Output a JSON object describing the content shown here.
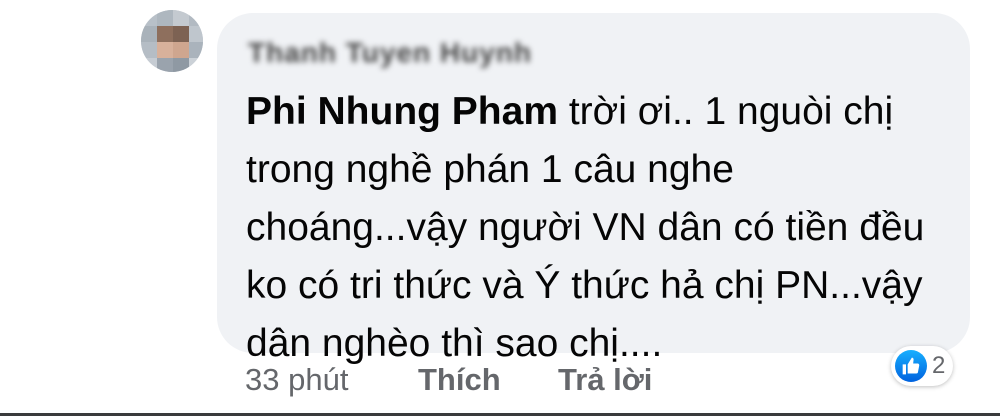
{
  "comment": {
    "author_name": "Thanh Tuyen Huynh",
    "mention": "Phi Nhung Pham",
    "text": " trời ơi.. 1 nguòi chị trong nghề phán 1 câu nghe choáng...vậy người VN dân có tiền đều ko có tri thức và Ý thức hả chị PN...vậy dân nghèo thì sao chị...."
  },
  "actions": {
    "timestamp": "33 phút",
    "like_label": "Thích",
    "reply_label": "Trả lời"
  },
  "reaction": {
    "icon": "like-icon",
    "count": "2",
    "color": "#1877F2"
  },
  "colors": {
    "bubble_bg": "#f0f2f5",
    "text": "#050505",
    "meta": "#65676b"
  }
}
